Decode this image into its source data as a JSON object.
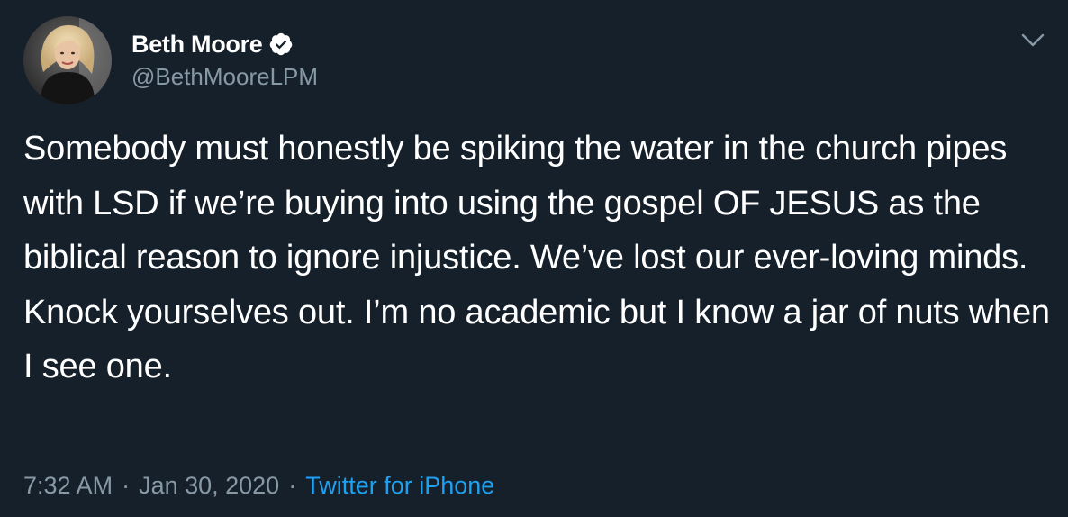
{
  "tweet": {
    "author": {
      "display_name": "Beth Moore",
      "handle": "@BethMooreLPM",
      "verified": true
    },
    "text": "Somebody must honestly be spiking the water in the church pipes with LSD if we’re buying into using the gospel OF JESUS as the biblical reason to ignore injustice. We’ve lost our ever-loving minds. Knock yourselves out. I’m no academic but I know a jar of nuts when I see one.",
    "time": "7:32 AM",
    "date": "Jan 30, 2020",
    "separator": "·",
    "source": "Twitter for iPhone"
  },
  "theme": {
    "background": "#15202b",
    "text": "#ffffff",
    "secondary_text": "#8899a6",
    "link": "#1da1f2",
    "verified_badge": "#ffffff"
  },
  "icons": {
    "verified": "verified-badge-icon",
    "menu": "chevron-down-icon"
  }
}
